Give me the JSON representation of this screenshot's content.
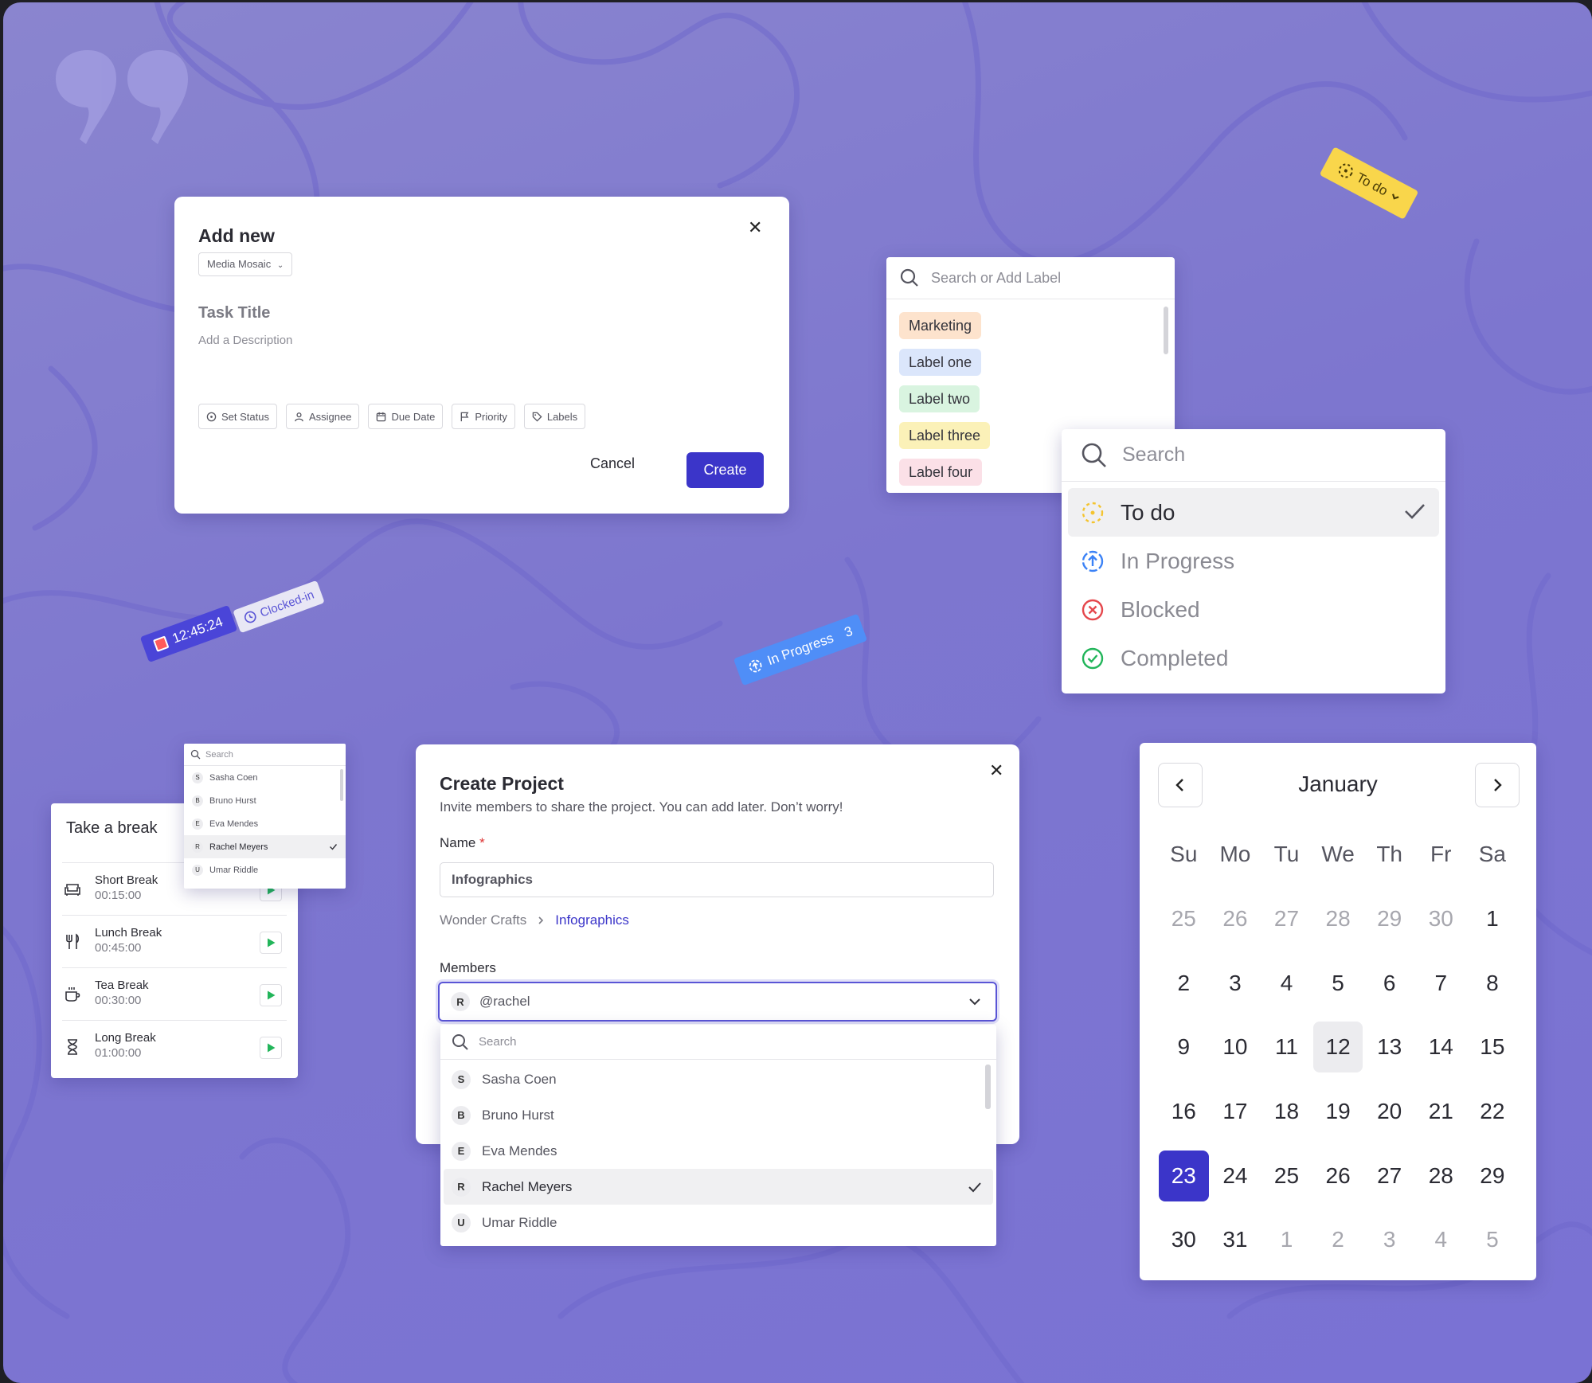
{
  "add_new": {
    "title": "Add new",
    "project": "Media Mosaic",
    "task_title": "Task Title",
    "description_placeholder": "Add a Description",
    "chips": [
      "Set Status",
      "Assignee",
      "Due Date",
      "Priority",
      "Labels"
    ],
    "cancel": "Cancel",
    "create": "Create"
  },
  "labels_dropdown": {
    "placeholder": "Search or Add Label",
    "items": [
      {
        "label": "Marketing",
        "color": "#fde3cd"
      },
      {
        "label": "Label one",
        "color": "#dbe6fb"
      },
      {
        "label": "Label two",
        "color": "#d9f4e0"
      },
      {
        "label": "Label three",
        "color": "#fbf1b8"
      },
      {
        "label": "Label four",
        "color": "#fbe0e7"
      }
    ]
  },
  "status_dropdown": {
    "placeholder": "Search",
    "items": [
      {
        "label": "To do",
        "icon": "todo-dashed-circle-icon",
        "color": "#f4c430",
        "selected": true
      },
      {
        "label": "In Progress",
        "icon": "in-progress-icon",
        "color": "#3b82f6",
        "selected": false
      },
      {
        "label": "Blocked",
        "icon": "blocked-x-icon",
        "color": "#e5484d",
        "selected": false
      },
      {
        "label": "Completed",
        "icon": "completed-check-icon",
        "color": "#22b55a",
        "selected": false
      }
    ]
  },
  "floating_tags": {
    "todo": "To do",
    "in_progress": "In Progress",
    "in_progress_count": "3",
    "timer": "12:45:24",
    "clocked_in": "Clocked-in"
  },
  "breaks": {
    "title": "Take a break",
    "items": [
      {
        "name": "Short Break",
        "time": "00:15:00",
        "icon": "couch-icon"
      },
      {
        "name": "Lunch Break",
        "time": "00:45:00",
        "icon": "fork-knife-icon"
      },
      {
        "name": "Tea Break",
        "time": "00:30:00",
        "icon": "cup-icon"
      },
      {
        "name": "Long Break",
        "time": "01:00:00",
        "icon": "hourglass-icon"
      }
    ]
  },
  "small_members": {
    "placeholder": "Search",
    "items": [
      {
        "initial": "S",
        "name": "Sasha Coen",
        "selected": false
      },
      {
        "initial": "B",
        "name": "Bruno Hurst",
        "selected": false
      },
      {
        "initial": "E",
        "name": "Eva Mendes",
        "selected": false
      },
      {
        "initial": "R",
        "name": "Rachel Meyers",
        "selected": true
      },
      {
        "initial": "U",
        "name": "Umar Riddle",
        "selected": false
      }
    ]
  },
  "create_project": {
    "title": "Create Project",
    "subtitle": "Invite members to share the project. You can add later. Don’t worry!",
    "name_label": "Name",
    "required_mark": "*",
    "name_value": "Infographics",
    "breadcrumb": [
      "Wonder Crafts",
      "Infographics"
    ],
    "members_label": "Members",
    "members_initial": "R",
    "members_value": "@rachel",
    "search_placeholder": "Search",
    "members": [
      {
        "initial": "S",
        "name": "Sasha Coen",
        "selected": false
      },
      {
        "initial": "B",
        "name": "Bruno Hurst",
        "selected": false
      },
      {
        "initial": "E",
        "name": "Eva Mendes",
        "selected": false
      },
      {
        "initial": "R",
        "name": "Rachel Meyers",
        "selected": true
      },
      {
        "initial": "U",
        "name": "Umar Riddle",
        "selected": false
      }
    ]
  },
  "calendar": {
    "month": "January",
    "weekdays": [
      "Su",
      "Mo",
      "Tu",
      "We",
      "Th",
      "Fr",
      "Sa"
    ],
    "weeks": [
      [
        "25",
        "26",
        "27",
        "28",
        "29",
        "30",
        "1"
      ],
      [
        "2",
        "3",
        "4",
        "5",
        "6",
        "7",
        "8"
      ],
      [
        "9",
        "10",
        "11",
        "12",
        "13",
        "14",
        "15"
      ],
      [
        "16",
        "17",
        "18",
        "19",
        "20",
        "21",
        "22"
      ],
      [
        "23",
        "24",
        "25",
        "26",
        "27",
        "28",
        "29"
      ],
      [
        "30",
        "31",
        "1",
        "2",
        "3",
        "4",
        "5"
      ]
    ],
    "today": "12",
    "selected": "23",
    "accent": "#3b35c9"
  }
}
